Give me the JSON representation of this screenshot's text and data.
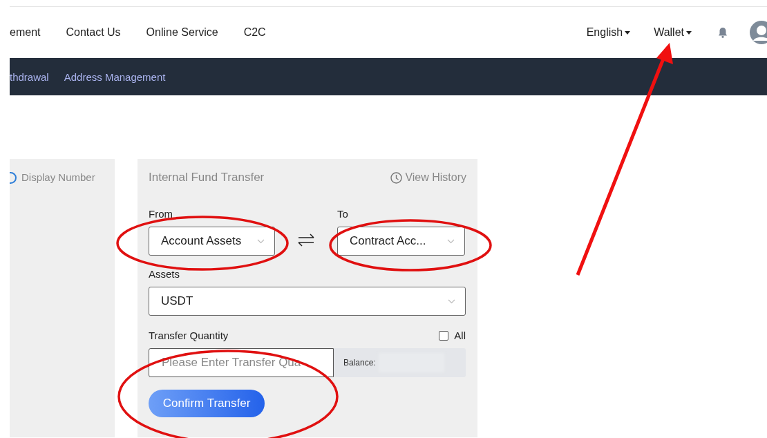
{
  "nav": {
    "items": [
      "ement",
      "Contact Us",
      "Online Service",
      "C2C"
    ],
    "menus": [
      {
        "label": "English"
      },
      {
        "label": "Wallet"
      }
    ]
  },
  "subnav": [
    "thdrawal",
    "Address Management"
  ],
  "side": {
    "toggle_label": "Display Number",
    "toggle_on": false
  },
  "transfer": {
    "title": "Internal Fund Transfer",
    "history_link": "View History",
    "from": {
      "label": "From",
      "value": "Account Assets"
    },
    "to": {
      "label": "To",
      "value": "Contract Acc..."
    },
    "assets": {
      "label": "Assets",
      "value": "USDT"
    },
    "quantity": {
      "label": "Transfer Quantity",
      "all": {
        "label": "All",
        "checked": false
      },
      "placeholder": "Please Enter Transfer Qua",
      "balance_label": "Balance:"
    },
    "button": "Confirm Transfer"
  }
}
